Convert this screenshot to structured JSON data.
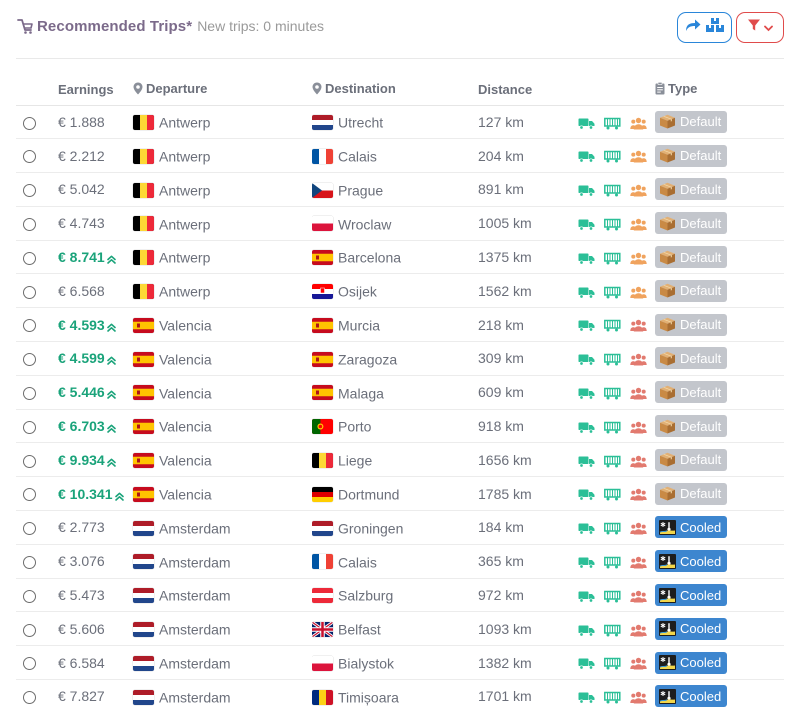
{
  "header": {
    "title": "Recommended Trips*",
    "subtitle": "New trips: 0 minutes"
  },
  "columns": {
    "earnings": "Earnings",
    "departure": "Departure",
    "destination": "Destination",
    "distance": "Distance",
    "type": "Type"
  },
  "colors": {
    "accent_green": "#1aa37a",
    "icon_teal": "#2bbf97",
    "icon_orange": "#f0a35e",
    "icon_red": "#e27a6f",
    "default_badge": "#c3c6cc",
    "cooled_badge": "#3d86cf",
    "share_button": "#2a86d9",
    "filter_button": "#e04b4b"
  },
  "trips": [
    {
      "earnings": "€ 1.888",
      "highlight": false,
      "from": "Antwerp",
      "from_flag": "be",
      "to": "Utrecht",
      "to_flag": "nl",
      "distance": "127 km",
      "person_icon": "orange",
      "type": "Default"
    },
    {
      "earnings": "€ 2.212",
      "highlight": false,
      "from": "Antwerp",
      "from_flag": "be",
      "to": "Calais",
      "to_flag": "fr",
      "distance": "204 km",
      "person_icon": "orange",
      "type": "Default"
    },
    {
      "earnings": "€ 5.042",
      "highlight": false,
      "from": "Antwerp",
      "from_flag": "be",
      "to": "Prague",
      "to_flag": "cz",
      "distance": "891 km",
      "person_icon": "orange",
      "type": "Default"
    },
    {
      "earnings": "€ 4.743",
      "highlight": false,
      "from": "Antwerp",
      "from_flag": "be",
      "to": "Wroclaw",
      "to_flag": "pl",
      "distance": "1005 km",
      "person_icon": "orange",
      "type": "Default"
    },
    {
      "earnings": "€ 8.741",
      "highlight": true,
      "from": "Antwerp",
      "from_flag": "be",
      "to": "Barcelona",
      "to_flag": "es",
      "distance": "1375 km",
      "person_icon": "orange",
      "type": "Default"
    },
    {
      "earnings": "€ 6.568",
      "highlight": false,
      "from": "Antwerp",
      "from_flag": "be",
      "to": "Osijek",
      "to_flag": "hr",
      "distance": "1562 km",
      "person_icon": "orange",
      "type": "Default"
    },
    {
      "earnings": "€ 4.593",
      "highlight": true,
      "from": "Valencia",
      "from_flag": "es",
      "to": "Murcia",
      "to_flag": "es",
      "distance": "218 km",
      "person_icon": "red",
      "type": "Default"
    },
    {
      "earnings": "€ 4.599",
      "highlight": true,
      "from": "Valencia",
      "from_flag": "es",
      "to": "Zaragoza",
      "to_flag": "es",
      "distance": "309 km",
      "person_icon": "red",
      "type": "Default"
    },
    {
      "earnings": "€ 5.446",
      "highlight": true,
      "from": "Valencia",
      "from_flag": "es",
      "to": "Malaga",
      "to_flag": "es",
      "distance": "609 km",
      "person_icon": "red",
      "type": "Default"
    },
    {
      "earnings": "€ 6.703",
      "highlight": true,
      "from": "Valencia",
      "from_flag": "es",
      "to": "Porto",
      "to_flag": "pt",
      "distance": "918 km",
      "person_icon": "red",
      "type": "Default"
    },
    {
      "earnings": "€ 9.934",
      "highlight": true,
      "from": "Valencia",
      "from_flag": "es",
      "to": "Liege",
      "to_flag": "be",
      "distance": "1656 km",
      "person_icon": "red",
      "type": "Default"
    },
    {
      "earnings": "€ 10.341",
      "highlight": true,
      "from": "Valencia",
      "from_flag": "es",
      "to": "Dortmund",
      "to_flag": "de",
      "distance": "1785 km",
      "person_icon": "red",
      "type": "Default"
    },
    {
      "earnings": "€ 2.773",
      "highlight": false,
      "from": "Amsterdam",
      "from_flag": "nl",
      "to": "Groningen",
      "to_flag": "nl",
      "distance": "184 km",
      "person_icon": "red",
      "type": "Cooled"
    },
    {
      "earnings": "€ 3.076",
      "highlight": false,
      "from": "Amsterdam",
      "from_flag": "nl",
      "to": "Calais",
      "to_flag": "fr",
      "distance": "365 km",
      "person_icon": "red",
      "type": "Cooled"
    },
    {
      "earnings": "€ 5.473",
      "highlight": false,
      "from": "Amsterdam",
      "from_flag": "nl",
      "to": "Salzburg",
      "to_flag": "at",
      "distance": "972 km",
      "person_icon": "red",
      "type": "Cooled"
    },
    {
      "earnings": "€ 5.606",
      "highlight": false,
      "from": "Amsterdam",
      "from_flag": "nl",
      "to": "Belfast",
      "to_flag": "gb",
      "distance": "1093 km",
      "person_icon": "red",
      "type": "Cooled"
    },
    {
      "earnings": "€ 6.584",
      "highlight": false,
      "from": "Amsterdam",
      "from_flag": "nl",
      "to": "Bialystok",
      "to_flag": "pl",
      "distance": "1382 km",
      "person_icon": "red",
      "type": "Cooled"
    },
    {
      "earnings": "€ 7.827",
      "highlight": false,
      "from": "Amsterdam",
      "from_flag": "nl",
      "to": "Timișoara",
      "to_flag": "ro",
      "distance": "1701 km",
      "person_icon": "red",
      "type": "Cooled"
    }
  ]
}
